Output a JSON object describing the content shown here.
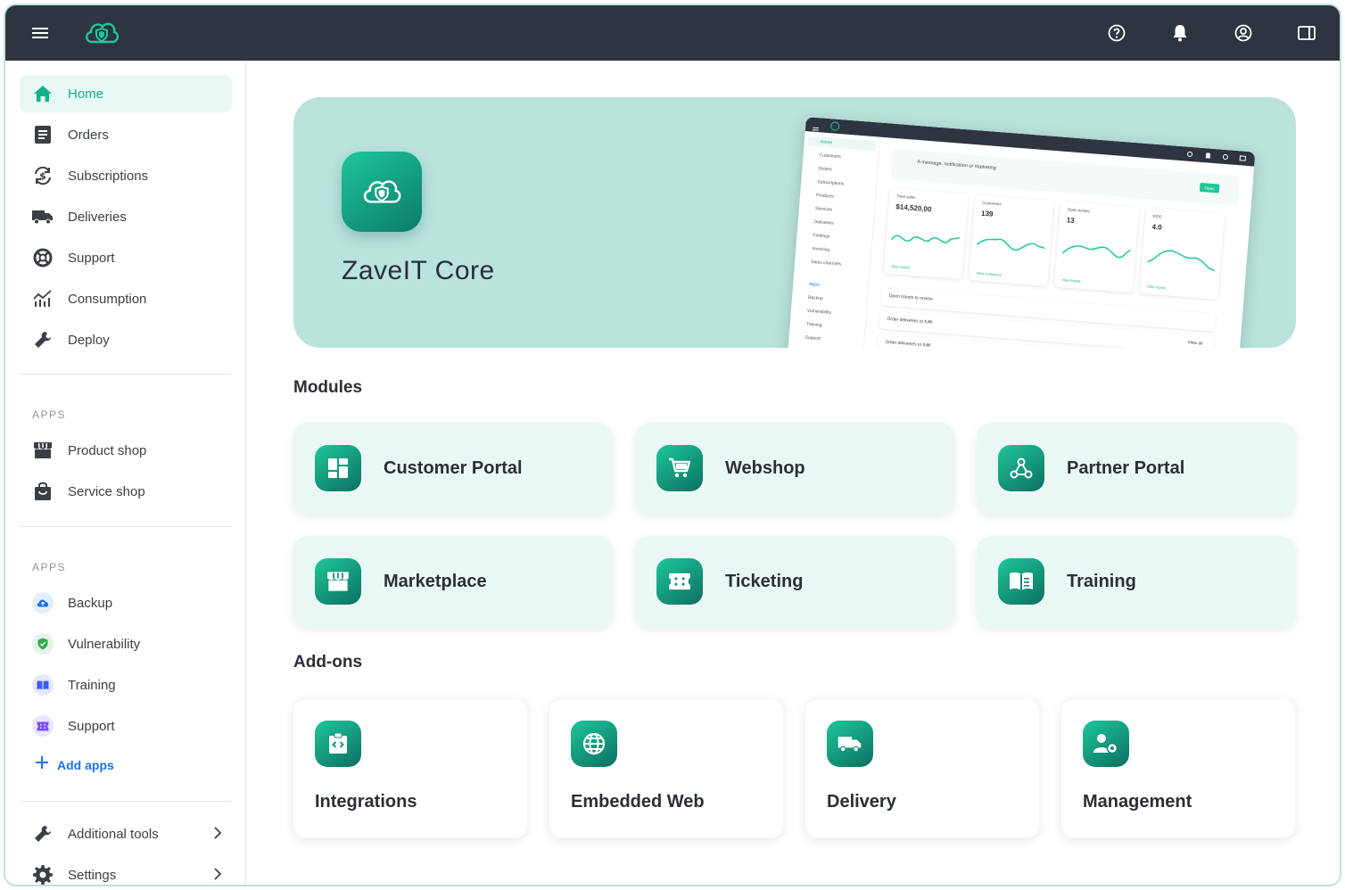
{
  "colors": {
    "topbar": "#2e3440",
    "accent": "#14b08a",
    "hero_bg": "#b9e3db",
    "card_bg": "#eaf8f5",
    "link": "#1a73e8"
  },
  "topbar": {
    "icons": [
      "menu-icon",
      "brand-logo-icon",
      "help-icon",
      "bell-icon",
      "account-icon",
      "panel-icon"
    ]
  },
  "sidebar": {
    "main_items": [
      {
        "label": "Home",
        "icon": "home-icon",
        "active": true
      },
      {
        "label": "Orders",
        "icon": "orders-icon"
      },
      {
        "label": "Subscriptions",
        "icon": "subscriptions-icon"
      },
      {
        "label": "Deliveries",
        "icon": "truck-icon"
      },
      {
        "label": "Support",
        "icon": "lifebuoy-icon"
      },
      {
        "label": "Consumption",
        "icon": "chart-icon"
      },
      {
        "label": "Deploy",
        "icon": "wrench-icon"
      }
    ],
    "apps_label_1": "APPS",
    "shop_items": [
      {
        "label": "Product shop",
        "icon": "storefront-icon"
      },
      {
        "label": "Service shop",
        "icon": "shopping-bag-icon"
      }
    ],
    "apps_label_2": "APPS",
    "app_items": [
      {
        "label": "Backup",
        "icon": "cloud-upload-icon",
        "color": "#1a73e8",
        "bg": "#e3eefc"
      },
      {
        "label": "Vulnerability",
        "icon": "shield-icon",
        "color": "#34a853",
        "bg": "#e4f4e8"
      },
      {
        "label": "Training",
        "icon": "book-icon",
        "color": "#3d5afe",
        "bg": "#e6e9fd"
      },
      {
        "label": "Support",
        "icon": "ticket-icon",
        "color": "#7c4dff",
        "bg": "#ece6fd"
      }
    ],
    "add_apps": "Add apps",
    "bottom_items": [
      {
        "label": "Additional tools",
        "icon": "wrench-icon"
      },
      {
        "label": "Settings",
        "icon": "gear-icon"
      }
    ]
  },
  "hero": {
    "title": "ZaveIT Core",
    "preview": {
      "nav": [
        "Home",
        "Customers",
        "Orders",
        "Subscriptions",
        "Products",
        "Services",
        "Deliveries",
        "Findings",
        "Invoicing",
        "Sales channels"
      ],
      "apps_label": "Apps",
      "apps": [
        "Backup",
        "Vulnerability",
        "Training",
        "Support"
      ],
      "message": "A message, notification or marketing",
      "open_label": "Open",
      "cards": [
        {
          "title": "Total sales",
          "value": "$14,520,00",
          "link": "View orders"
        },
        {
          "title": "Customers",
          "value": "139",
          "link": "View customers"
        },
        {
          "title": "Open tickets",
          "value": "13",
          "link": "View tickets"
        },
        {
          "title": "RISC",
          "value": "4.0",
          "link": "View report"
        }
      ],
      "rows": [
        "Open tickets to review",
        "Order deliveries to fulfil",
        "Order deliveries to fulfil"
      ],
      "view_all": "View all"
    }
  },
  "modules": {
    "title": "Modules",
    "items": [
      {
        "label": "Customer Portal",
        "icon": "dashboard-icon"
      },
      {
        "label": "Webshop",
        "icon": "cart-icon"
      },
      {
        "label": "Partner Portal",
        "icon": "network-icon"
      },
      {
        "label": "Marketplace",
        "icon": "storefront-icon"
      },
      {
        "label": "Ticketing",
        "icon": "ticket-icon"
      },
      {
        "label": "Training",
        "icon": "book-icon"
      }
    ]
  },
  "addons": {
    "title": "Add-ons",
    "items": [
      {
        "label": "Integrations",
        "icon": "code-clipboard-icon"
      },
      {
        "label": "Embedded Web",
        "icon": "globe-icon"
      },
      {
        "label": "Delivery",
        "icon": "truck-icon"
      },
      {
        "label": "Management",
        "icon": "user-gear-icon"
      }
    ]
  }
}
